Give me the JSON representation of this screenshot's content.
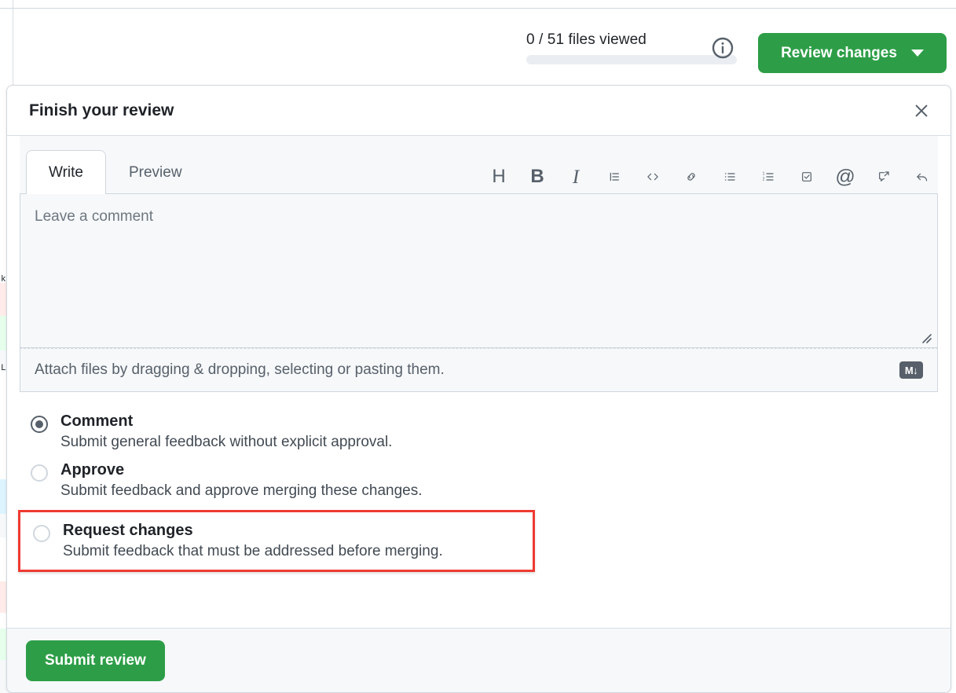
{
  "header": {
    "files_viewed_label": "0 / 51 files viewed",
    "files_viewed_progress_percent": 0,
    "info_icon": "info-circle-icon",
    "review_changes_label": "Review changes",
    "review_changes_color": "#2d9e47",
    "caret_icon": "chevron-down-icon"
  },
  "dialog": {
    "title": "Finish your review",
    "close_icon": "close-x-icon",
    "tabs": [
      {
        "label": "Write",
        "active": true
      },
      {
        "label": "Preview",
        "active": false
      }
    ],
    "toolbar": [
      {
        "name": "heading-icon",
        "glyph": "H",
        "title": "Heading"
      },
      {
        "name": "bold-icon",
        "glyph": "B",
        "title": "Bold"
      },
      {
        "name": "italic-icon",
        "glyph": "I",
        "title": "Italic"
      },
      {
        "name": "quote-icon",
        "glyph": "",
        "title": "Quote"
      },
      {
        "name": "code-icon",
        "glyph": "<>",
        "title": "Code"
      },
      {
        "name": "link-icon",
        "glyph": "",
        "title": "Link"
      },
      {
        "name": "unordered-list-icon",
        "glyph": "",
        "title": "Bulleted list"
      },
      {
        "name": "ordered-list-icon",
        "glyph": "",
        "title": "Numbered list"
      },
      {
        "name": "task-list-icon",
        "glyph": "",
        "title": "Task list"
      },
      {
        "name": "mention-icon",
        "glyph": "@",
        "title": "Mention"
      },
      {
        "name": "saved-reply-icon",
        "glyph": "",
        "title": "Reference a saved reply"
      },
      {
        "name": "reply-icon",
        "glyph": "",
        "title": "Reply"
      }
    ],
    "comment_placeholder": "Leave a comment",
    "comment_value": "",
    "attach_text": "Attach files by dragging & dropping, selecting or pasting them.",
    "markdown_badge_label": "M",
    "markdown_badge_arrow": "↓",
    "options": [
      {
        "title": "Comment",
        "description": "Submit general feedback without explicit approval.",
        "selected": true,
        "highlighted": false
      },
      {
        "title": "Approve",
        "description": "Submit feedback and approve merging these changes.",
        "selected": false,
        "highlighted": false
      },
      {
        "title": "Request changes",
        "description": "Submit feedback that must be addressed before merging.",
        "selected": false,
        "highlighted": true
      }
    ],
    "highlight_color": "#ef3a32",
    "submit_label": "Submit review",
    "submit_color": "#2d9e47"
  }
}
